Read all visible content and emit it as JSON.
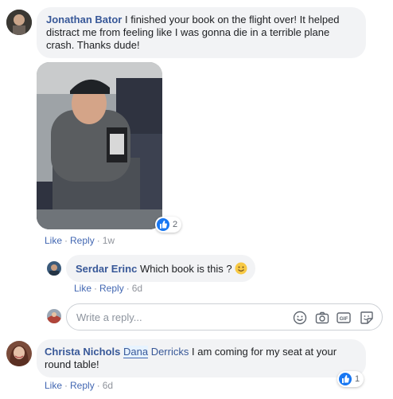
{
  "comments": [
    {
      "author": "Jonathan Bator",
      "text": "I finished your book on the flight over! It helped distract me from feeling like I was gonna die in a terrible plane crash. Thanks dude!",
      "reaction_count": "2",
      "like_label": "Like",
      "reply_label": "Reply",
      "time": "1w"
    },
    {
      "author": "Christa Nichols",
      "mention_first": "Dana",
      "mention_rest": "Derricks",
      "text": "I am coming for my seat at your round table!",
      "reaction_count": "1",
      "like_label": "Like",
      "reply_label": "Reply",
      "time": "6d"
    }
  ],
  "reply": {
    "author": "Serdar Erinc",
    "text": "Which book is this ?",
    "emoji": "smile-emoji",
    "like_label": "Like",
    "reply_label": "Reply",
    "time": "6d"
  },
  "reply_box": {
    "placeholder": "Write a reply..."
  },
  "colors": {
    "link": "#385898",
    "bubble": "#f2f3f5",
    "like_blue": "#1877f2"
  }
}
